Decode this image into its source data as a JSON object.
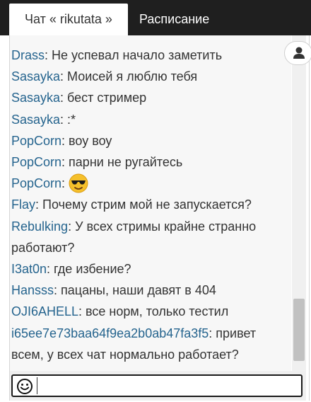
{
  "tabs": {
    "chat_label": "Чат « rikutata »",
    "schedule_label": "Расписание"
  },
  "messages": [
    {
      "nick": "Drass",
      "text": ": Не успевал начало заметить"
    },
    {
      "nick": "Sasayka",
      "text": ": Моисей я люблю тебя"
    },
    {
      "nick": "Sasayka",
      "text": ": бест стример"
    },
    {
      "nick": "Sasayka",
      "text": ": :*"
    },
    {
      "nick": "PopCorn",
      "text": ": воу воу"
    },
    {
      "nick": "PopCorn",
      "text": ": парни не ругайтесь"
    },
    {
      "nick": "PopCorn",
      "text": ": ",
      "emoji": "sunglasses-emoji"
    },
    {
      "nick": "Flay",
      "text": ": Почему стрим мой не запускается?"
    },
    {
      "nick": "Rebulking",
      "text": ": У всех стримы крайне странно работают?"
    },
    {
      "nick": "I3at0n",
      "text": ": где избение?"
    },
    {
      "nick": "Hansss",
      "text": ": пацаны, наши давят в 404"
    },
    {
      "nick": "OJI6AHELL",
      "text": ": все норм, только тестил"
    },
    {
      "nick": "i65ee7e73baa64f9ea2b0ab47fa3f5",
      "text": ": привет всем, у всех чат нормально работает?"
    }
  ],
  "input": {
    "value": "",
    "placeholder": ""
  },
  "icons": {
    "user_list": "user-icon",
    "smiley": "smiley-icon"
  },
  "colors": {
    "tabbar_bg": "#1f1f1f",
    "nick": "#25648e",
    "text": "#333333",
    "messages_bg": "#f7f7f7"
  }
}
